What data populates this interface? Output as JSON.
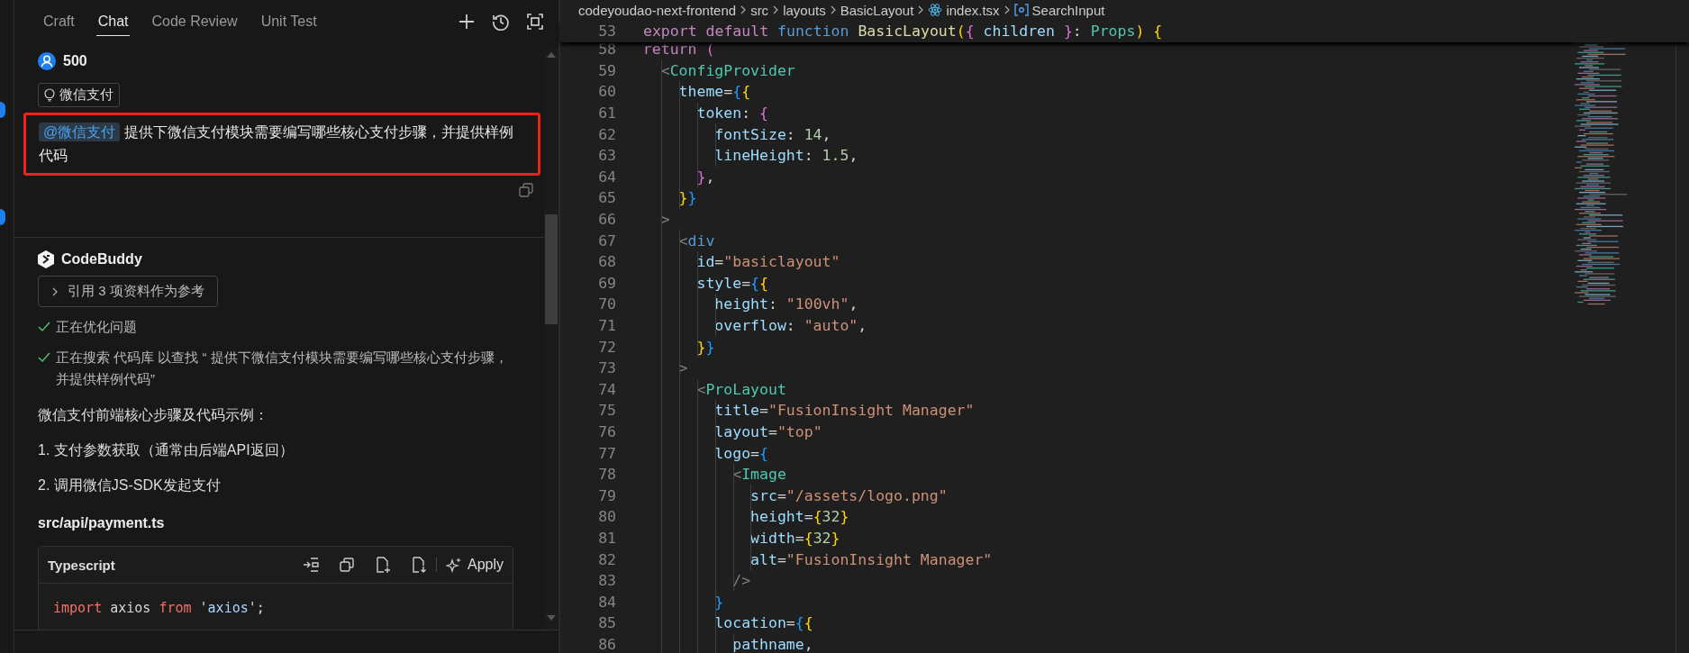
{
  "chat_panel": {
    "tabs": [
      {
        "label": "Craft",
        "selected": false
      },
      {
        "label": "Chat",
        "selected": true
      },
      {
        "label": "Code Review",
        "selected": false
      },
      {
        "label": "Unit Test",
        "selected": false
      }
    ]
  },
  "user_message": {
    "author": "500",
    "context_chip": "微信支付",
    "mention": "@微信支付",
    "text": "提供下微信支付模块需要编写哪些核心支付步骤，并提供样例代码"
  },
  "assistant_message": {
    "author": "CodeBuddy",
    "references": "引用 3 项资料作为参考",
    "steps": [
      {
        "text": "正在优化问题",
        "done": true
      },
      {
        "text": "正在搜索 代码库 以查找 “ 提供下微信支付模块需要编写哪些核心支付步骤，并提供样例代码”",
        "done": true
      }
    ],
    "paragraphs": [
      "微信支付前端核心步骤及代码示例：",
      "1. 支付参数获取（通常由后端API返回）",
      "2. 调用微信JS-SDK发起支付"
    ],
    "file": "src/api/payment.ts",
    "code_block": {
      "language": "Typescript",
      "apply": "Apply",
      "lines": [
        [
          {
            "text": "import",
            "kind": "keyword"
          },
          {
            "text": " axios ",
            "kind": "plain"
          },
          {
            "text": "from",
            "kind": "keyword"
          },
          {
            "text": " '",
            "kind": "plain"
          },
          {
            "text": "axios",
            "kind": "string"
          },
          {
            "text": "';",
            "kind": "plain"
          }
        ]
      ]
    }
  },
  "editor": {
    "breadcrumb": [
      {
        "label": "codeyoudao-next-frontend",
        "kind": "folder"
      },
      {
        "label": "src",
        "kind": "folder"
      },
      {
        "label": "layouts",
        "kind": "folder"
      },
      {
        "label": "BasicLayout",
        "kind": "folder"
      },
      {
        "label": "index.tsx",
        "kind": "file"
      },
      {
        "label": "SearchInput",
        "kind": "symbol"
      }
    ],
    "sticky_line": {
      "num": "53",
      "tokens": [
        {
          "text": "export default ",
          "kind": "control"
        },
        {
          "text": "function ",
          "kind": "keyword"
        },
        {
          "text": "BasicLayout",
          "kind": "function"
        },
        {
          "text": "(",
          "kind": "bracket1"
        },
        {
          "text": "{",
          "kind": "bracket2"
        },
        {
          "text": " children ",
          "kind": "variable"
        },
        {
          "text": "}",
          "kind": "bracket2"
        },
        {
          "text": ": ",
          "kind": "plain"
        },
        {
          "text": "Props",
          "kind": "type"
        },
        {
          "text": ")",
          "kind": "bracket1"
        },
        {
          "text": " {",
          "kind": "bracket1"
        }
      ]
    },
    "lines": [
      {
        "num": "58",
        "tokens": [
          {
            "text": "  return ",
            "kind": "control"
          },
          {
            "text": "(",
            "kind": "bracket2"
          }
        ]
      },
      {
        "num": "59",
        "tokens": [
          {
            "text": "    <",
            "kind": "punct"
          },
          {
            "text": "ConfigProvider",
            "kind": "type"
          }
        ]
      },
      {
        "num": "60",
        "tokens": [
          {
            "text": "      theme",
            "kind": "variable"
          },
          {
            "text": "=",
            "kind": "plain"
          },
          {
            "text": "{",
            "kind": "bracket3"
          },
          {
            "text": "{",
            "kind": "bracket1"
          }
        ]
      },
      {
        "num": "61",
        "tokens": [
          {
            "text": "        token",
            "kind": "variable"
          },
          {
            "text": ": ",
            "kind": "plain"
          },
          {
            "text": "{",
            "kind": "bracket2"
          }
        ]
      },
      {
        "num": "62",
        "tokens": [
          {
            "text": "          fontSize",
            "kind": "variable"
          },
          {
            "text": ": ",
            "kind": "plain"
          },
          {
            "text": "14",
            "kind": "number"
          },
          {
            "text": ",",
            "kind": "plain"
          }
        ]
      },
      {
        "num": "63",
        "tokens": [
          {
            "text": "          lineHeight",
            "kind": "variable"
          },
          {
            "text": ": ",
            "kind": "plain"
          },
          {
            "text": "1.5",
            "kind": "number"
          },
          {
            "text": ",",
            "kind": "plain"
          }
        ]
      },
      {
        "num": "64",
        "tokens": [
          {
            "text": "        }",
            "kind": "bracket2"
          },
          {
            "text": ",",
            "kind": "plain"
          }
        ]
      },
      {
        "num": "65",
        "tokens": [
          {
            "text": "      }",
            "kind": "bracket1"
          },
          {
            "text": "}",
            "kind": "bracket3"
          }
        ]
      },
      {
        "num": "66",
        "tokens": [
          {
            "text": "    >",
            "kind": "punct"
          }
        ]
      },
      {
        "num": "67",
        "tokens": [
          {
            "text": "      <",
            "kind": "punct"
          },
          {
            "text": "div",
            "kind": "keyword"
          }
        ]
      },
      {
        "num": "68",
        "tokens": [
          {
            "text": "        id",
            "kind": "variable"
          },
          {
            "text": "=",
            "kind": "plain"
          },
          {
            "text": "\"basiclayout\"",
            "kind": "string"
          }
        ]
      },
      {
        "num": "69",
        "tokens": [
          {
            "text": "        style",
            "kind": "variable"
          },
          {
            "text": "=",
            "kind": "plain"
          },
          {
            "text": "{",
            "kind": "bracket3"
          },
          {
            "text": "{",
            "kind": "bracket1"
          }
        ]
      },
      {
        "num": "70",
        "tokens": [
          {
            "text": "          height",
            "kind": "variable"
          },
          {
            "text": ": ",
            "kind": "plain"
          },
          {
            "text": "\"100vh\"",
            "kind": "string"
          },
          {
            "text": ",",
            "kind": "plain"
          }
        ]
      },
      {
        "num": "71",
        "tokens": [
          {
            "text": "          overflow",
            "kind": "variable"
          },
          {
            "text": ": ",
            "kind": "plain"
          },
          {
            "text": "\"auto\"",
            "kind": "string"
          },
          {
            "text": ",",
            "kind": "plain"
          }
        ]
      },
      {
        "num": "72",
        "tokens": [
          {
            "text": "        }",
            "kind": "bracket1"
          },
          {
            "text": "}",
            "kind": "bracket3"
          }
        ]
      },
      {
        "num": "73",
        "tokens": [
          {
            "text": "      >",
            "kind": "punct"
          }
        ]
      },
      {
        "num": "74",
        "tokens": [
          {
            "text": "        <",
            "kind": "punct"
          },
          {
            "text": "ProLayout",
            "kind": "type"
          }
        ]
      },
      {
        "num": "75",
        "tokens": [
          {
            "text": "          title",
            "kind": "variable"
          },
          {
            "text": "=",
            "kind": "plain"
          },
          {
            "text": "\"FusionInsight Manager\"",
            "kind": "string"
          }
        ]
      },
      {
        "num": "76",
        "tokens": [
          {
            "text": "          layout",
            "kind": "variable"
          },
          {
            "text": "=",
            "kind": "plain"
          },
          {
            "text": "\"top\"",
            "kind": "string"
          }
        ]
      },
      {
        "num": "77",
        "tokens": [
          {
            "text": "          logo",
            "kind": "variable"
          },
          {
            "text": "=",
            "kind": "plain"
          },
          {
            "text": "{",
            "kind": "bracket3"
          }
        ]
      },
      {
        "num": "78",
        "tokens": [
          {
            "text": "            <",
            "kind": "punct"
          },
          {
            "text": "Image",
            "kind": "type"
          }
        ]
      },
      {
        "num": "79",
        "tokens": [
          {
            "text": "              src",
            "kind": "variable"
          },
          {
            "text": "=",
            "kind": "plain"
          },
          {
            "text": "\"/assets/logo.png\"",
            "kind": "string"
          }
        ]
      },
      {
        "num": "80",
        "tokens": [
          {
            "text": "              height",
            "kind": "variable"
          },
          {
            "text": "=",
            "kind": "plain"
          },
          {
            "text": "{",
            "kind": "bracket1"
          },
          {
            "text": "32",
            "kind": "number"
          },
          {
            "text": "}",
            "kind": "bracket1"
          }
        ]
      },
      {
        "num": "81",
        "tokens": [
          {
            "text": "              width",
            "kind": "variable"
          },
          {
            "text": "=",
            "kind": "plain"
          },
          {
            "text": "{",
            "kind": "bracket1"
          },
          {
            "text": "32",
            "kind": "number"
          },
          {
            "text": "}",
            "kind": "bracket1"
          }
        ]
      },
      {
        "num": "82",
        "tokens": [
          {
            "text": "              alt",
            "kind": "variable"
          },
          {
            "text": "=",
            "kind": "plain"
          },
          {
            "text": "\"FusionInsight Manager\"",
            "kind": "string"
          }
        ]
      },
      {
        "num": "83",
        "tokens": [
          {
            "text": "            />",
            "kind": "punct"
          }
        ]
      },
      {
        "num": "84",
        "tokens": [
          {
            "text": "          }",
            "kind": "bracket3"
          }
        ]
      },
      {
        "num": "85",
        "tokens": [
          {
            "text": "          location",
            "kind": "variable"
          },
          {
            "text": "=",
            "kind": "plain"
          },
          {
            "text": "{",
            "kind": "bracket3"
          },
          {
            "text": "{",
            "kind": "bracket1"
          }
        ]
      },
      {
        "num": "86",
        "tokens": [
          {
            "text": "            pathname",
            "kind": "variable"
          },
          {
            "text": ",",
            "kind": "plain"
          }
        ]
      }
    ]
  }
}
